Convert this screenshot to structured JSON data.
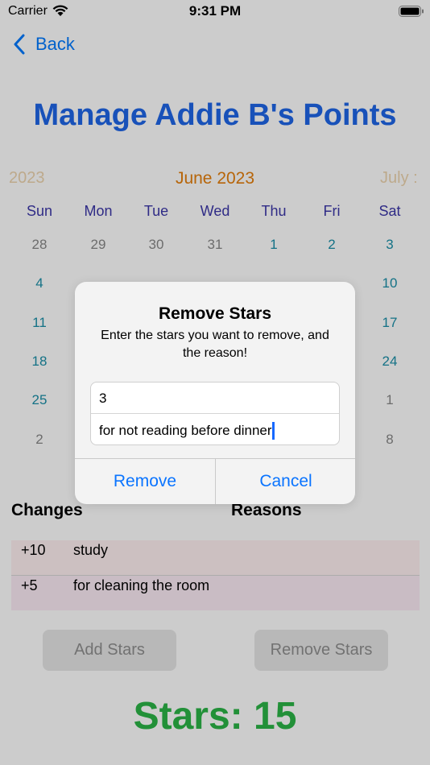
{
  "status_bar": {
    "carrier": "Carrier",
    "time": "9:31 PM"
  },
  "nav": {
    "back_label": "Back"
  },
  "title": "Manage Addie B's Points",
  "calendar": {
    "prev_month": "2023",
    "current_month": "June 2023",
    "next_month": "July :",
    "weekdays": [
      "Sun",
      "Mon",
      "Tue",
      "Wed",
      "Thu",
      "Fri",
      "Sat"
    ],
    "weeks": [
      [
        "28",
        "29",
        "30",
        "31",
        "1",
        "2",
        "3"
      ],
      [
        "4",
        "",
        "",
        "",
        "",
        "",
        "10"
      ],
      [
        "11",
        "",
        "",
        "",
        "",
        "",
        "17"
      ],
      [
        "18",
        "",
        "",
        "",
        "",
        "",
        "24"
      ],
      [
        "25",
        "",
        "",
        "",
        "",
        "",
        "1"
      ],
      [
        "2",
        "",
        "",
        "",
        "",
        "",
        "8"
      ]
    ],
    "muted": [
      [
        true,
        true,
        true,
        true,
        false,
        false,
        false
      ],
      [
        false,
        false,
        false,
        false,
        false,
        false,
        false
      ],
      [
        false,
        false,
        false,
        false,
        false,
        false,
        false
      ],
      [
        false,
        false,
        false,
        false,
        false,
        false,
        false
      ],
      [
        false,
        false,
        false,
        false,
        false,
        false,
        true
      ],
      [
        true,
        false,
        false,
        false,
        false,
        false,
        true
      ]
    ]
  },
  "changes": {
    "header_changes": "Changes",
    "header_reasons": "Reasons",
    "rows": [
      {
        "amount": "+10",
        "reason": "study"
      },
      {
        "amount": "+5",
        "reason": "for cleaning the room"
      }
    ]
  },
  "buttons": {
    "add_stars": "Add Stars",
    "remove_stars": "Remove Stars"
  },
  "stars_total": "Stars: 15",
  "alert": {
    "title": "Remove Stars",
    "message": "Enter the stars you want to remove, and the reason!",
    "stars_value": "3",
    "reason_value": "for not reading before dinner",
    "remove_label": "Remove",
    "cancel_label": "Cancel"
  },
  "icons": {
    "wifi": "wifi-icon",
    "battery": "battery-icon",
    "back": "chevron-left-icon"
  },
  "colors": {
    "title": "#1e66e8",
    "accent": "#007aff",
    "month": "#e57f0c",
    "weekday": "#3b36a8",
    "day": "#1a8fa8",
    "stars": "#2bb546"
  }
}
